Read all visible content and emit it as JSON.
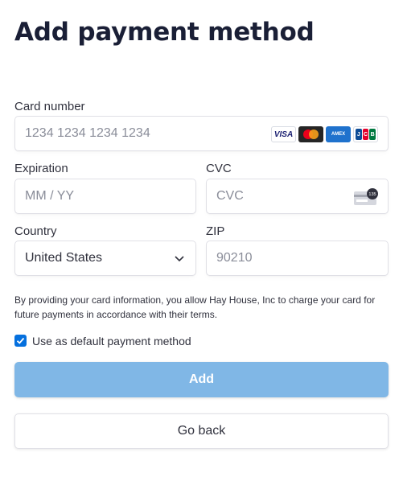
{
  "page": {
    "title": "Add payment method"
  },
  "card": {
    "label": "Card number",
    "placeholder": "1234 1234 1234 1234",
    "brands": [
      "visa-icon",
      "mastercard-icon",
      "amex-icon",
      "jcb-icon"
    ],
    "visa_text": "VISA",
    "amex_text": "AMEX",
    "jcb_letters": [
      "J",
      "C",
      "B"
    ]
  },
  "expiration": {
    "label": "Expiration",
    "placeholder": "MM / YY"
  },
  "cvc": {
    "label": "CVC",
    "placeholder": "CVC",
    "badge": "135"
  },
  "country": {
    "label": "Country",
    "selected": "United States"
  },
  "zip": {
    "label": "ZIP",
    "placeholder": "90210"
  },
  "disclaimer": "By providing your card information, you allow Hay House, Inc to charge your card for future payments in accordance with their terms.",
  "default_checkbox": {
    "label": "Use as default payment method",
    "checked": true
  },
  "buttons": {
    "add": "Add",
    "back": "Go back"
  },
  "colors": {
    "title": "#1a1f36",
    "accent": "#0570de",
    "add_button": "#80b7e6"
  }
}
